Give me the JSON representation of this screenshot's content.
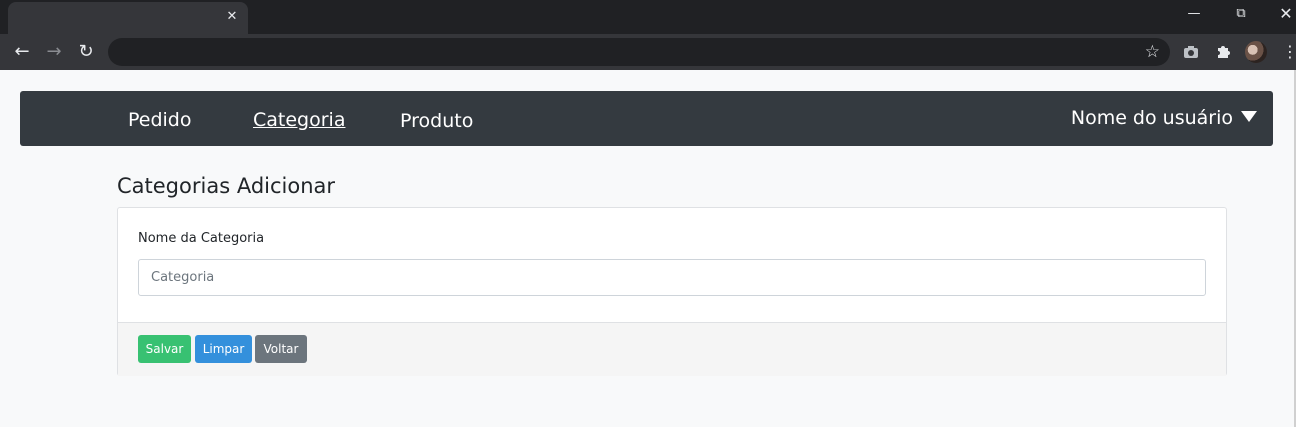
{
  "browser": {
    "tab_close_glyph": "✕",
    "icons": {
      "back": "back-arrow-icon",
      "forward": "forward-arrow-icon",
      "reload": "reload-icon",
      "bookmark": "star-icon",
      "screenshot": "camera-icon",
      "extensions": "puzzle-icon",
      "profile": "avatar-icon",
      "menu": "kebab-menu-icon",
      "minimize": "minimize-icon",
      "restore": "restore-icon",
      "close": "close-icon"
    }
  },
  "navbar": {
    "links": [
      {
        "label": "Pedido",
        "active": false
      },
      {
        "label": "Categoria",
        "active": true
      },
      {
        "label": "Produto",
        "active": false
      }
    ],
    "user_label": "Nome do usuário"
  },
  "page": {
    "title": "Categorias Adicionar"
  },
  "form": {
    "field_label": "Nome da Categoria",
    "field_placeholder": "Categoria",
    "field_value": ""
  },
  "actions": {
    "save_label": "Salvar",
    "clear_label": "Limpar",
    "back_label": "Voltar"
  },
  "colors": {
    "navbar_bg": "#343a40",
    "save_bg": "#38c172",
    "clear_bg": "#3490dc",
    "back_bg": "#6c757d",
    "page_bg": "#f8f9fa"
  }
}
